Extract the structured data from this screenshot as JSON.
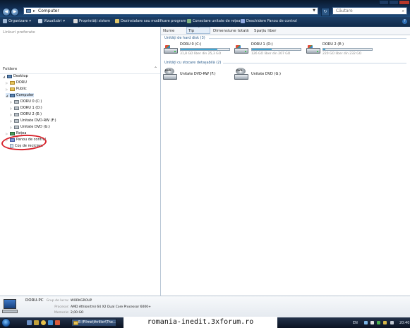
{
  "address": {
    "location": "Computer"
  },
  "search": {
    "placeholder": "Căutare"
  },
  "toolbar": {
    "organize": "Organizare",
    "views": "Vizualizări",
    "properties": "Proprietăți sistem",
    "uninstall": "Dezinstalare sau modificare program",
    "map_drive": "Conectare unitate de rețea",
    "control_panel": "Deschidere Panou de control"
  },
  "left": {
    "fav_links": "Linkuri preferate",
    "folders_label": "Foldere",
    "tree": {
      "desktop": "Desktop",
      "doru": "DORU",
      "public": "Public",
      "computer": "Computer",
      "drive_c": "DORU 0 (C:)",
      "drive_d": "DORU 1 (D:)",
      "drive_e": "DORU 2 (E:)",
      "dvdrw": "Unitate DVD-RW (F:)",
      "dvd": "Unitate DVD (G:)",
      "network": "Rețea",
      "control_panel": "Panou de control",
      "recycle_bin": "Coș de reciclare"
    }
  },
  "columns": {
    "name": "Nume",
    "type": "Tip",
    "total": "Dimensiune totală",
    "free": "Spațiu liber"
  },
  "groups": {
    "hdd": "Unități de hard disk (3)",
    "removable": "Unități cu stocare detașabilă (2)"
  },
  "drives": [
    {
      "name": "DORU 0 (C:)",
      "free_text": "31,8 GO liber din 25,3 GO",
      "used_fraction": 0.75
    },
    {
      "name": "DORU 1 (D:)",
      "free_text": "126 GO liber din 207 GO",
      "used_fraction": 0.4
    },
    {
      "name": "DORU 2 (E:)",
      "free_text": "220 GO liber din 232 GO",
      "used_fraction": 0.05
    }
  ],
  "removable": [
    {
      "name": "Unitate DVD-RW (F:)",
      "badge": "DVD"
    },
    {
      "name": "Unitate DVD (G:)",
      "badge": "DVD"
    }
  ],
  "details": {
    "pc_name": "DORU-PC",
    "workgroup_label": "Grup de lucru:",
    "workgroup_value": "WORKGROUP",
    "processor_label": "Procesor:",
    "processor_value": "AMD Athlon(tm) 64 X2 Dual Core Processor 6000+",
    "memory_label": "Memorie:",
    "memory_value": "2,00 GO"
  },
  "taskbar": {
    "task": "E:\\Filme\\thriller\\The...",
    "lang": "EN",
    "clock": "20:40"
  },
  "watermark": "romania-inedit.3xforum.ro",
  "colors": {
    "accent": "#1e3f66",
    "annotation": "#d8252e",
    "bar_fill": "#2a8fc2"
  }
}
